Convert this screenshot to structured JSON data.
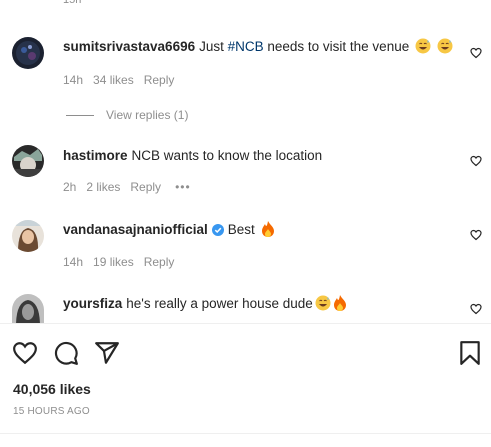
{
  "top_cut_text": "15h",
  "comments": [
    {
      "username": "sumitsrivastava6696",
      "text_before": "Just ",
      "tag": "#NCB",
      "text_after": " needs to visit the venue",
      "time": "14h",
      "likes": "34 likes",
      "reply": "Reply",
      "emojis": [
        "grinning-sweat-emoji",
        "grinning-sweat-emoji"
      ]
    },
    {
      "username": "hastimore",
      "text": "NCB wants to know the location",
      "time": "2h",
      "likes": "2 likes",
      "reply": "Reply",
      "more": "•••"
    },
    {
      "username": "vandanasajnaniofficial",
      "verified": true,
      "text": "Best",
      "time": "14h",
      "likes": "19 likes",
      "reply": "Reply",
      "emojis": [
        "fire-emoji"
      ]
    },
    {
      "username": "yoursfiza",
      "text": "he's really a power house dude",
      "emojis": [
        "grinning-sweat-emoji",
        "fire-emoji"
      ]
    }
  ],
  "view_replies": "View replies (1)",
  "post": {
    "likes": "40,056 likes",
    "time_ago": "15 HOURS AGO"
  },
  "icons": [
    "heart-icon",
    "comment-icon",
    "share-icon",
    "bookmark-icon",
    "verified-badge-icon",
    "more-icon"
  ],
  "colors": {
    "text": "#262626",
    "muted": "#8e8e8e",
    "tag": "#00376b",
    "verified": "#3897f0",
    "fire": "#f56a00"
  }
}
